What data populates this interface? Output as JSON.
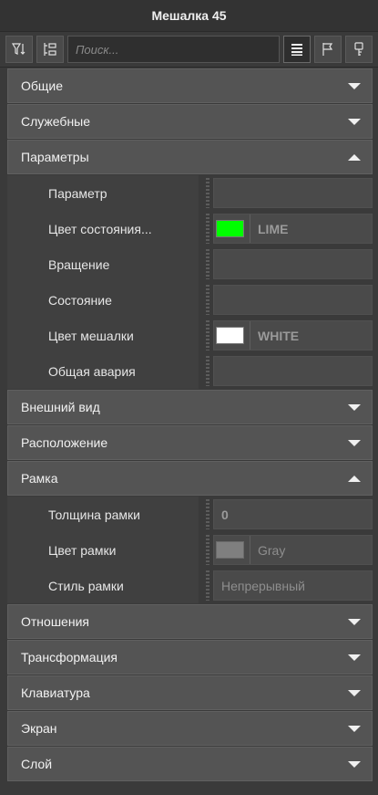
{
  "window": {
    "title": "Мешалка 45"
  },
  "toolbar": {
    "search_placeholder": "Поиск...",
    "buttons": [
      "sort-filter-icon",
      "expand-tree-icon",
      "list-icon",
      "flag-icon",
      "key-icon"
    ]
  },
  "sections": {
    "general": "Общие",
    "service": "Служебные",
    "params": "Параметры",
    "appearance": "Внешний вид",
    "layout": "Расположение",
    "frame": "Рамка",
    "relations": "Отношения",
    "transform": "Трансформация",
    "keyboard": "Клавиатура",
    "screen": "Экран",
    "layer": "Слой"
  },
  "params": {
    "param": {
      "name": "Параметр",
      "value": ""
    },
    "state_color": {
      "name": "Цвет состояния...",
      "value": "LIME",
      "color": "#00ff00"
    },
    "rotation": {
      "name": "Вращение",
      "value": ""
    },
    "state": {
      "name": "Состояние",
      "value": ""
    },
    "mixer_color": {
      "name": "Цвет мешалки",
      "value": "WHITE",
      "color": "#ffffff"
    },
    "alarm": {
      "name": "Общая авария",
      "value": ""
    }
  },
  "frame": {
    "thickness": {
      "name": "Толщина рамки",
      "value": "0"
    },
    "color": {
      "name": "Цвет рамки",
      "value": "Gray",
      "color": "#7f7f7f"
    },
    "style": {
      "name": "Стиль рамки",
      "value": "Непрерывный"
    }
  }
}
